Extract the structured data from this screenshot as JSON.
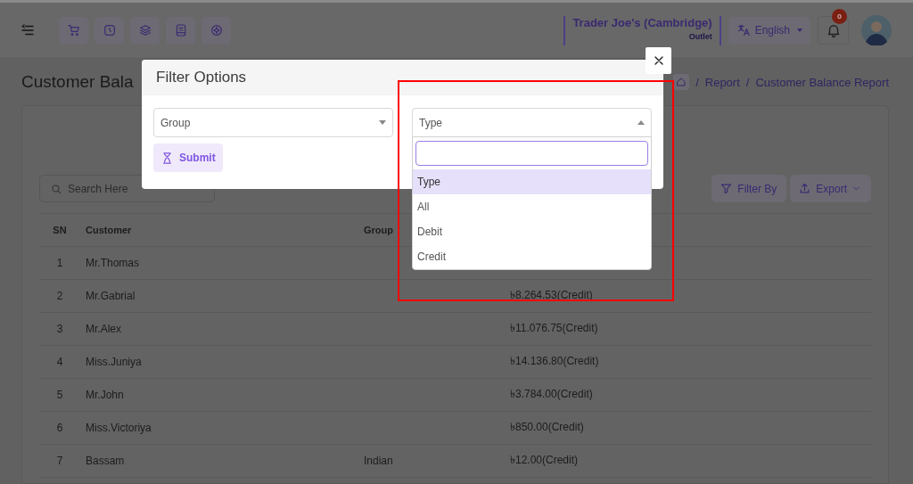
{
  "topbar": {
    "store": "Trader Joe's (Cambridge)",
    "store_type": "Outlet",
    "language": "English",
    "notifications": "0"
  },
  "page": {
    "title": "Customer Bala",
    "breadcrumb": [
      {
        "separator": "/",
        "label": "Report"
      },
      {
        "separator": "/",
        "label": "Customer Balance Report"
      }
    ]
  },
  "search": {
    "placeholder": "Search Here"
  },
  "actions": [
    "Filter By",
    "Export"
  ],
  "table": {
    "columns": [
      "SN",
      "Customer",
      "Group"
    ],
    "rows": [
      {
        "sn": "1",
        "customer": "Mr.Thomas"
      },
      {
        "sn": "2",
        "customer": "Mr.Gabrial",
        "balance": "৳8.264.53(Credit)"
      },
      {
        "sn": "3",
        "customer": "Mr.Alex",
        "balance": "৳11.076.75(Credit)"
      },
      {
        "sn": "4",
        "customer": "Miss.Juniya",
        "balance": "৳14.136.80(Credit)"
      },
      {
        "sn": "5",
        "customer": "Mr.John",
        "balance": "৳3.784.00(Credit)"
      },
      {
        "sn": "6",
        "customer": "Miss.Victoriya",
        "balance": "৳850.00(Credit)"
      },
      {
        "sn": "7",
        "customer": "Bassam",
        "group": "Indian",
        "balance": "৳12.00(Credit)"
      }
    ]
  },
  "modal": {
    "title": "Filter Options",
    "group_select": {
      "placeholder": "Group"
    },
    "type_select": {
      "value": "Type",
      "expanded": true,
      "options": [
        {
          "label": "Type",
          "selected": true
        },
        {
          "label": "All",
          "selected": false
        },
        {
          "label": "Debit",
          "selected": false
        },
        {
          "label": "Credit",
          "selected": false
        }
      ]
    },
    "submit": "Submit"
  }
}
